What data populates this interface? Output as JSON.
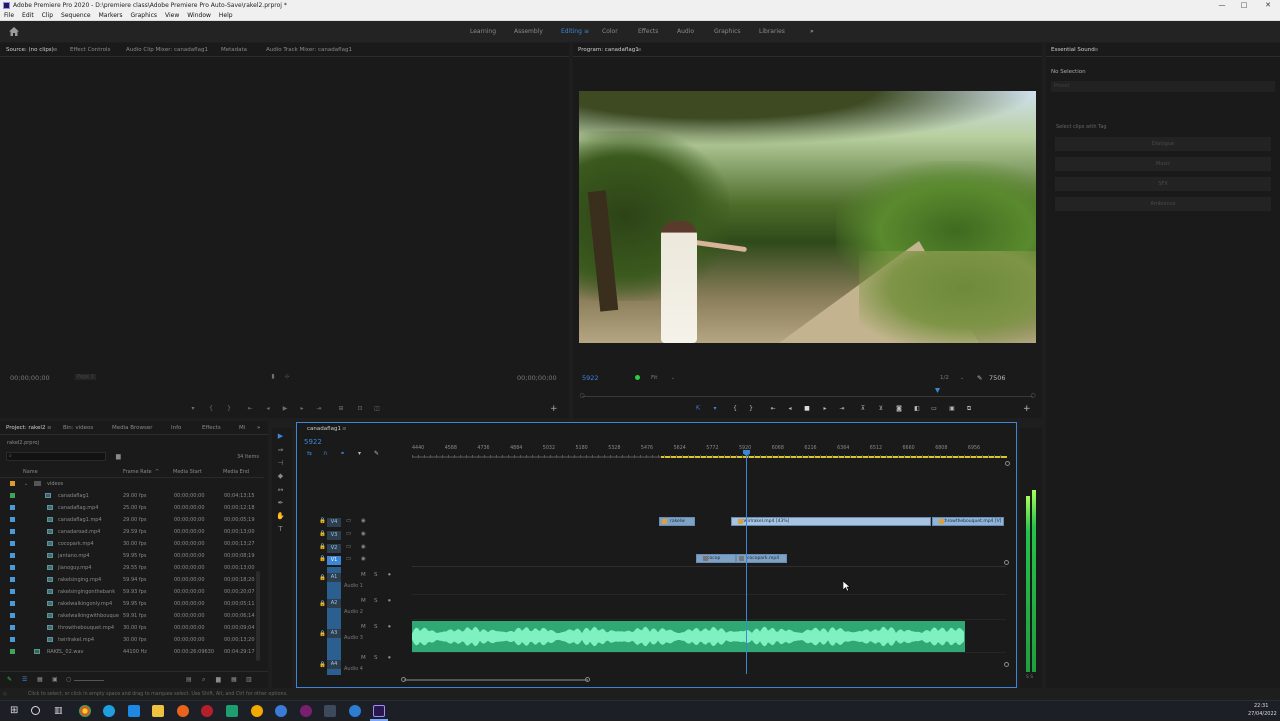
{
  "window": {
    "title": "Adobe Premiere Pro 2020 - D:\\premiere class\\Adobe Premiere Pro Auto-Save\\rakel2.prproj *",
    "minimize": "—",
    "maximize": "□",
    "close": "✕"
  },
  "menu": [
    "File",
    "Edit",
    "Clip",
    "Sequence",
    "Markers",
    "Graphics",
    "View",
    "Window",
    "Help"
  ],
  "workspaces": [
    {
      "label": "Learning"
    },
    {
      "label": "Assembly"
    },
    {
      "label": "Editing"
    },
    {
      "label": "Color"
    },
    {
      "label": "Effects"
    },
    {
      "label": "Audio"
    },
    {
      "label": "Graphics"
    },
    {
      "label": "Libraries"
    },
    {
      "label": "»"
    }
  ],
  "active_workspace": "Editing",
  "source_panel": {
    "tabs": [
      "Source: (no clips)",
      "Effect Controls",
      "Audio Clip Mixer: canadaflag1",
      "Metadata",
      "Audio Track Mixer: canadaflag1"
    ],
    "timecode_left": "00;00;00;00",
    "page_label": "Page 1",
    "timecode_right": "00;00;00;00"
  },
  "program_panel": {
    "tab": "Program: canadaflag1",
    "timecode": "5922",
    "zoom": "Fit",
    "quality": "1/2",
    "duration": "7506"
  },
  "essential_sound": {
    "tab": "Essential Sound",
    "selection": "No Selection",
    "preset_placeholder": "Preset",
    "hint": "Select clips with Tag",
    "buttons": [
      "Dialogue",
      "Music",
      "SFX",
      "Ambience"
    ]
  },
  "project_panel": {
    "tabs": [
      "Project: rakel2",
      "Bin: videos",
      "Media Browser",
      "Info",
      "Effects",
      "Mi"
    ],
    "file": "rakel2.prproj",
    "items_count": "34 Items",
    "columns": {
      "name": "Name",
      "frame_rate": "Frame Rate",
      "media_start": "Media Start",
      "media_end": "Media End"
    },
    "folder": "videos",
    "rows": [
      {
        "name": "canadaflag1",
        "fr": "29.00 fps",
        "ms": "00;00;00;00",
        "me": "00;04;13;15",
        "color": "#3fa35a",
        "seq": true
      },
      {
        "name": "canadaflag.mp4",
        "fr": "25.00 fps",
        "ms": "00;00;00;00",
        "me": "00;00;12;18",
        "color": "#4a9ad8"
      },
      {
        "name": "canadaflag1.mp4",
        "fr": "29.00 fps",
        "ms": "00;00;00;00",
        "me": "00;00;05;19",
        "color": "#4a9ad8"
      },
      {
        "name": "canadaroad.mp4",
        "fr": "29.59 fps",
        "ms": "00;00;00;00",
        "me": "00;00;13;00",
        "color": "#4a9ad8"
      },
      {
        "name": "cocopark.mp4",
        "fr": "30.00 fps",
        "ms": "00;00;00;00",
        "me": "00;00;13;27",
        "color": "#4a9ad8"
      },
      {
        "name": "jantano.mp4",
        "fr": "59.95 fps",
        "ms": "00;00;00;00",
        "me": "00;00;08;19",
        "color": "#4a9ad8"
      },
      {
        "name": "jianoguy.mp4",
        "fr": "29.55 fps",
        "ms": "00;00;00;00",
        "me": "00;00;13;00",
        "color": "#4a9ad8"
      },
      {
        "name": "rakelsinging.mp4",
        "fr": "59.94 fps",
        "ms": "00;00;00;00",
        "me": "00;00;18;20",
        "color": "#4a9ad8"
      },
      {
        "name": "rakelsingingonthebank",
        "fr": "59.93 fps",
        "ms": "00;00;00;00",
        "me": "00;00;20;07",
        "color": "#4a9ad8"
      },
      {
        "name": "rakelwalkingonly.mp4",
        "fr": "59.95 fps",
        "ms": "00;00;00;00",
        "me": "00;00;05;11",
        "color": "#4a9ad8"
      },
      {
        "name": "rakelwalkingwithbouque",
        "fr": "59.91 fps",
        "ms": "00;00;00;00",
        "me": "00;00;06;14",
        "color": "#4a9ad8"
      },
      {
        "name": "throwthebouquet.mp4",
        "fr": "30.00 fps",
        "ms": "00;00;00;00",
        "me": "00;00;09;04",
        "color": "#4a9ad8"
      },
      {
        "name": "twirlrakel.mp4",
        "fr": "30.00 fps",
        "ms": "00;00;00;00",
        "me": "00;00;13;20",
        "color": "#4a9ad8"
      },
      {
        "name": "RAKEL_02.wav",
        "fr": "44100 Hz",
        "ms": "00:00:26:09630",
        "me": "00:04:29:17",
        "color": "#3fa35a",
        "audio": true
      }
    ]
  },
  "timeline": {
    "tab": "canadaflag1",
    "timecode": "5922",
    "ruler": [
      "4440",
      "4588",
      "4736",
      "4884",
      "5032",
      "5180",
      "5328",
      "5476",
      "5624",
      "5772",
      "5920",
      "6068",
      "6216",
      "6364",
      "6512",
      "6660",
      "6808",
      "6956"
    ],
    "video_tracks": [
      "V4",
      "V3",
      "V2",
      "V1"
    ],
    "audio_tracks": [
      {
        "id": "A1",
        "name": "Audio 1"
      },
      {
        "id": "A2",
        "name": "Audio 2"
      },
      {
        "id": "A3",
        "name": "Audio 3"
      },
      {
        "id": "A4",
        "name": "Audio 4"
      }
    ],
    "clips": {
      "v4_a": "rakelw",
      "v4_b": "twirlrakel.mp4 [43%]",
      "v4_c": "throwthebouquet.mp4 [V]",
      "v1_a": "cocop",
      "v1_b": "cocopark.mp4"
    },
    "meter_label": "S S"
  },
  "status_bar": "Click to select, or click in empty space and drag to marquee select. Use Shift, Alt, and Ctrl for other options.",
  "clock": {
    "time": "22:31",
    "date": "27/04/2022"
  },
  "colors": {
    "accent": "#3d86d6",
    "audio_clip": "#3bbf86",
    "video_clip": "#8fb3d9",
    "meter": "#27c24a"
  }
}
